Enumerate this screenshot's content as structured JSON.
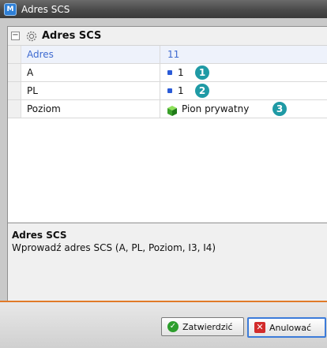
{
  "window": {
    "title": "Adres SCS",
    "icon": "app-icon"
  },
  "category": {
    "label": "Adres SCS",
    "icon": "gear-icon",
    "collapse_glyph": "−"
  },
  "properties": [
    {
      "name": "Adres",
      "value": "11",
      "selected": true
    },
    {
      "name": "A",
      "value": "1",
      "icon": "blue-square-icon",
      "badge": "1"
    },
    {
      "name": "PL",
      "value": "1",
      "icon": "blue-square-icon",
      "badge": "2"
    },
    {
      "name": "Poziom",
      "value": "Pion prywatny",
      "icon": "green-cube-icon",
      "badge": "3"
    }
  ],
  "description": {
    "title": "Adres SCS",
    "text": "Wprowadź adres SCS (A, PL, Poziom, I3, I4)"
  },
  "buttons": {
    "ok": {
      "label": "Zatwierdzić",
      "icon": "check-icon"
    },
    "cancel": {
      "label": "Anulować",
      "icon": "close-icon"
    }
  },
  "colors": {
    "accent_orange": "#e07a28",
    "badge_teal": "#1f9aa5",
    "selection_text": "#3f6bd0"
  }
}
